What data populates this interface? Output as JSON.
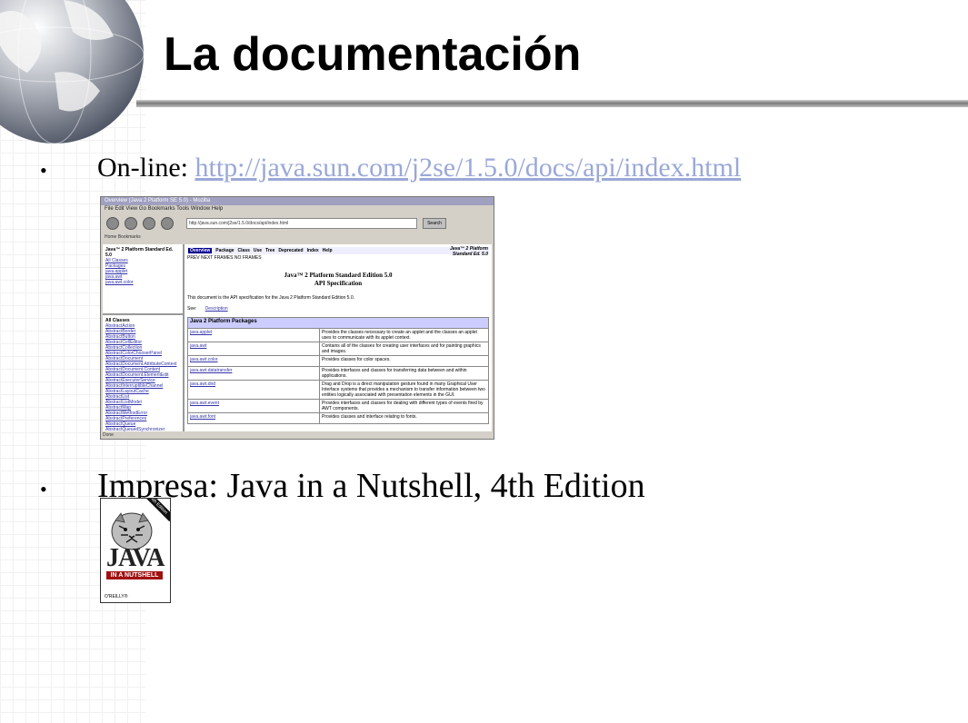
{
  "slide": {
    "title": "La documentación",
    "bullet_char": "•",
    "online_label": "On-line:",
    "online_url": "http://java.sun.com/j2se/1.5.0/docs/api/index.html",
    "print_text": "Impresa: Java in a Nutshell, 4th Edition"
  },
  "browser": {
    "window_title": "Overview (Java 2 Platform SE 5.0) - Mozilla",
    "menu": "File Edit View Go Bookmarks Tools Window Help",
    "url": "http://java.sun.com/j2se/1.5.0/docs/api/index.html",
    "search_label": "Search",
    "bookmarks": "Home  Bookmarks",
    "left_top_title": "Java™ 2 Platform Standard Ed. 5.0",
    "left_top_links": [
      "All Classes",
      "Packages",
      "java.applet",
      "java.awt",
      "java.awt.color"
    ],
    "left_bottom_title": "All Classes",
    "left_bottom_links": [
      "AbstractAction",
      "AbstractBorder",
      "AbstractButton",
      "AbstractCellEditor",
      "AbstractCollection",
      "AbstractColorChooserPanel",
      "AbstractDocument",
      "AbstractDocument.AttributeContext",
      "AbstractDocument.Content",
      "AbstractDocument.ElementEdit",
      "AbstractExecutorService",
      "AbstractInterruptibleChannel",
      "AbstractLayoutCache",
      "AbstractList",
      "AbstractListModel",
      "AbstractMap",
      "AbstractMethodError",
      "AbstractPreferences",
      "AbstractQueue",
      "AbstractQueuedSynchronizer",
      "AbstractSelectableChannel",
      "AbstractSelectionKey",
      "AbstractSelector"
    ],
    "nav": [
      "Overview",
      "Package",
      "Class",
      "Use",
      "Tree",
      "Deprecated",
      "Index",
      "Help"
    ],
    "corner_title": "Java™ 2 Platform Standard Ed. 5.0",
    "nav_sub": "PREV NEXT     FRAMES  NO FRAMES",
    "spec_title_1": "Java™ 2 Platform Standard Edition 5.0",
    "spec_title_2": "API Specification",
    "intro": "This document is the API specification for the Java 2 Platform Standard Edition 5.0.",
    "see_label": "See:",
    "see_link": "Description",
    "table_header": "Java 2 Platform Packages",
    "packages": [
      {
        "name": "java.applet",
        "desc": "Provides the classes necessary to create an applet and the classes an applet uses to communicate with its applet context."
      },
      {
        "name": "java.awt",
        "desc": "Contains all of the classes for creating user interfaces and for painting graphics and images."
      },
      {
        "name": "java.awt.color",
        "desc": "Provides classes for color spaces."
      },
      {
        "name": "java.awt.datatransfer",
        "desc": "Provides interfaces and classes for transferring data between and within applications."
      },
      {
        "name": "java.awt.dnd",
        "desc": "Drag and Drop is a direct manipulation gesture found in many Graphical User Interface systems that provides a mechanism to transfer information between two entities logically associated with presentation elements in the GUI."
      },
      {
        "name": "java.awt.event",
        "desc": "Provides interfaces and classes for dealing with different types of events fired by AWT components."
      },
      {
        "name": "java.awt.font",
        "desc": "Provides classes and interface relating to fonts."
      }
    ],
    "status": "Done"
  },
  "book": {
    "edition_banner": "4th Edition",
    "title": "JAVA",
    "subtitle": "IN A NUTSHELL",
    "publisher": "O'REILLY®"
  }
}
